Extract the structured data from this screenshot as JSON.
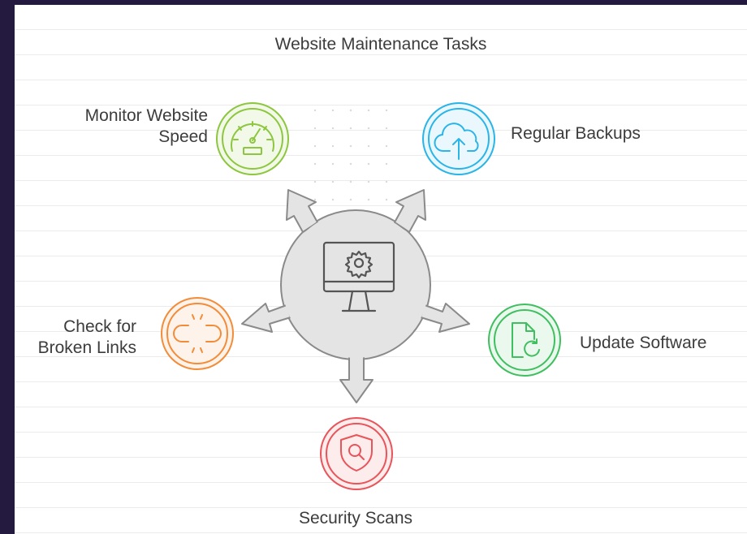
{
  "title": "Website Maintenance Tasks",
  "hub": {
    "icon": "monitor-gear-icon",
    "color": "#b3b3b3"
  },
  "tasks": [
    {
      "id": "speed",
      "lines": [
        "Monitor Website",
        "Speed"
      ],
      "icon": "speedometer-icon",
      "color": "#8dc63f"
    },
    {
      "id": "backups",
      "lines": [
        "Regular Backups"
      ],
      "icon": "cloud-upload-icon",
      "color": "#2ab4e8"
    },
    {
      "id": "software",
      "lines": [
        "Update Software"
      ],
      "icon": "document-refresh-icon",
      "color": "#3fbf5f"
    },
    {
      "id": "security",
      "lines": [
        "Security Scans"
      ],
      "icon": "shield-search-icon",
      "color": "#e8545a"
    },
    {
      "id": "links",
      "lines": [
        "Check for",
        "Broken Links"
      ],
      "icon": "broken-link-icon",
      "color": "#f28c38"
    }
  ]
}
